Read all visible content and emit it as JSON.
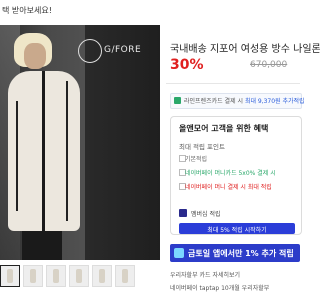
{
  "top_notice": "택 받아보세요!",
  "brand_logo": "G/FORE",
  "product": {
    "title": "국내배송 지포어 여성용 방수 나일론",
    "discount": "30%",
    "original_price": "670,000"
  },
  "payment_notice": {
    "prefix": "라인프렌즈카드 결제 시",
    "highlight": "최대 9,370원 추가적립"
  },
  "member_box": {
    "title": "올앤모어 고객을 위한 혜택",
    "subtitle": "최대 적립 포인트",
    "items": [
      "기본적립",
      "네이버페이 머니카드 5x0% 결제 시",
      "네이버페이 머니 결제 시 최대 적립"
    ],
    "note": "멤버십 적립",
    "button": "최대 5% 적립 시작하기"
  },
  "banner": {
    "text": "금토일 앱에서만 1% 추가 적립"
  },
  "footnotes": [
    "우리자할부 카드 자세히보기",
    "네이버페이 taptap 10개월 우리자할부"
  ],
  "thumbnails": [
    {
      "label": "thumb1"
    },
    {
      "label": "thumb2"
    },
    {
      "label": "thumb3"
    },
    {
      "label": "thumb4"
    },
    {
      "label": "thumb5"
    },
    {
      "label": "thumb6"
    }
  ]
}
